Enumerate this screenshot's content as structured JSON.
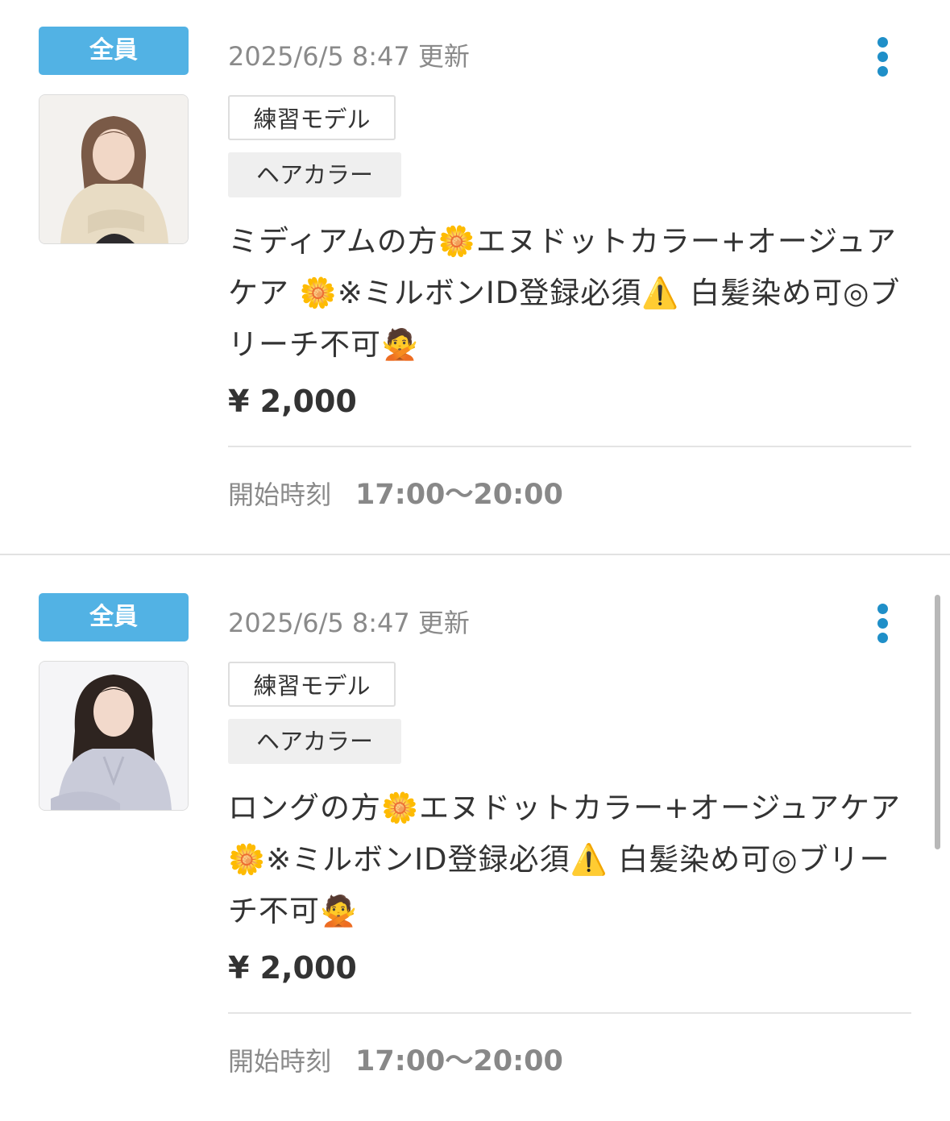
{
  "accent_color": "#52b2e4",
  "menu_icon": "more-vertical-icon",
  "posts": [
    {
      "audience_badge": "全員",
      "updated_at": "2025/6/5 8:47 更新",
      "tags": [
        "練習モデル",
        "ヘアカラー"
      ],
      "title": "ミディアムの方🌼エヌドットカラー+オージュアケア 🌼※ミルボンID登録必須⚠️ 白髪染め可◎ブリーチ不可🙅",
      "price": "¥ 2,000",
      "time_label": "開始時刻",
      "time_value": "17:00〜20:00"
    },
    {
      "audience_badge": "全員",
      "updated_at": "2025/6/5 8:47 更新",
      "tags": [
        "練習モデル",
        "ヘアカラー"
      ],
      "title": "ロングの方🌼エヌドットカラー+オージュアケア 🌼※ミルボンID登録必須⚠️ 白髪染め可◎ブリーチ不可🙅",
      "price": "¥ 2,000",
      "time_label": "開始時刻",
      "time_value": "17:00〜20:00"
    }
  ]
}
